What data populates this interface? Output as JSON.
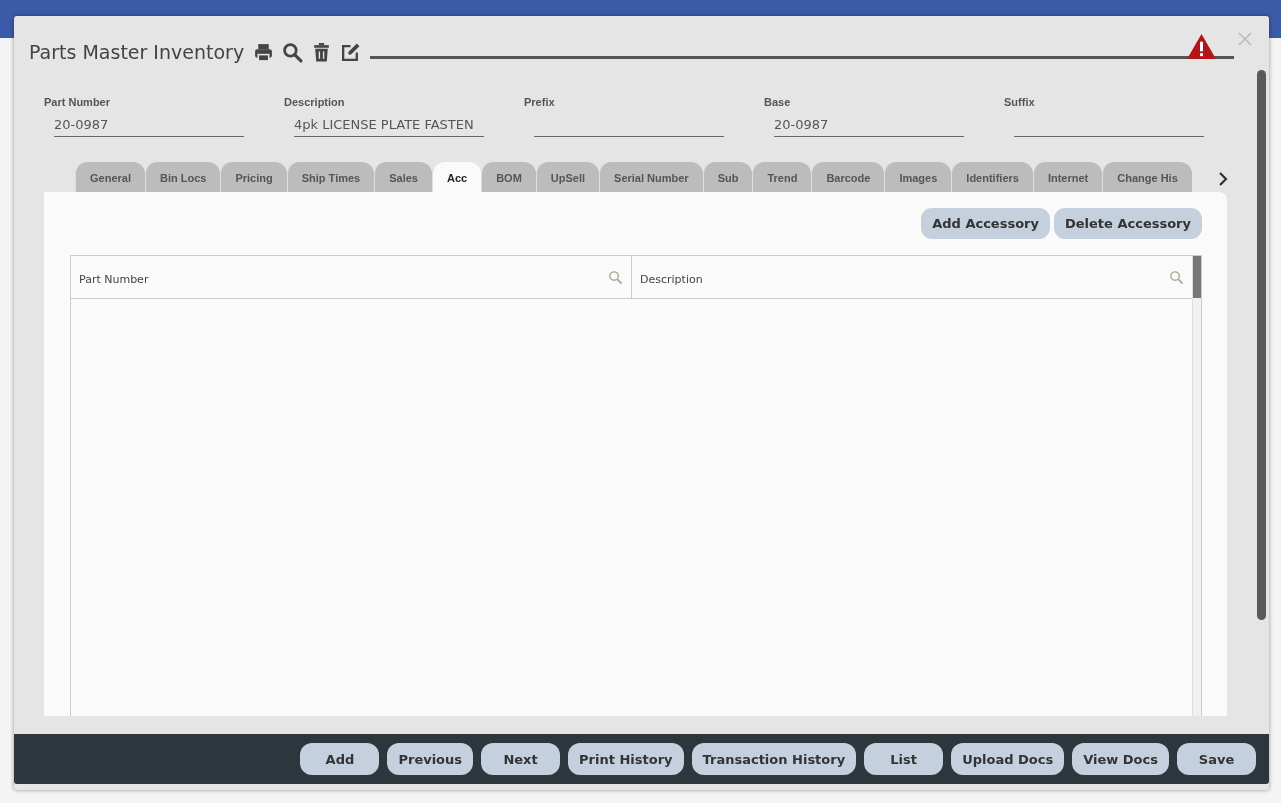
{
  "window": {
    "title": "Parts Master Inventory"
  },
  "header_fields": [
    {
      "label": "Part Number",
      "value": "20-0987"
    },
    {
      "label": "Description",
      "value": "4pk LICENSE PLATE FASTEN"
    },
    {
      "label": "Prefix"
    },
    {
      "label": "Base",
      "value": "20-0987"
    },
    {
      "label": "Suffix"
    }
  ],
  "tabs": [
    {
      "label": "General",
      "selected": false
    },
    {
      "label": "Bin Locs",
      "selected": false
    },
    {
      "label": "Pricing",
      "selected": false
    },
    {
      "label": "Ship Times",
      "selected": false
    },
    {
      "label": "Sales",
      "selected": false
    },
    {
      "label": "Acc",
      "selected": true
    },
    {
      "label": "BOM",
      "selected": false
    },
    {
      "label": "UpSell",
      "selected": false
    },
    {
      "label": "Serial Number",
      "selected": false
    },
    {
      "label": "Sub",
      "selected": false
    },
    {
      "label": "Trend",
      "selected": false
    },
    {
      "label": "Barcode",
      "selected": false
    },
    {
      "label": "Images",
      "selected": false
    },
    {
      "label": "Identifiers",
      "selected": false
    },
    {
      "label": "Internet",
      "selected": false
    },
    {
      "label": "Change His",
      "selected": false
    }
  ],
  "panel_buttons": [
    "Add Accessory",
    "Delete Accessory"
  ],
  "table": {
    "columns": [
      "Part Number",
      "Description"
    ]
  },
  "footer_buttons": [
    "Add",
    "Previous",
    "Next",
    "Print History",
    "Transaction History",
    "List",
    "Upload Docs",
    "View Docs",
    "Save"
  ]
}
